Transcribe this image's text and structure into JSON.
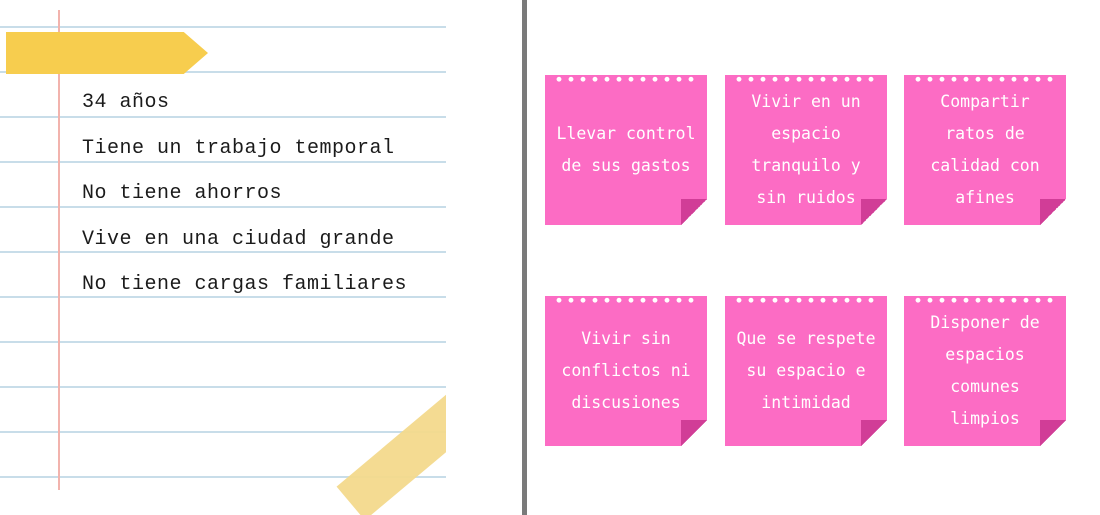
{
  "notebook": {
    "facts": [
      "34 años",
      "Tiene un trabajo temporal",
      "No tiene ahorros",
      "Vive en una ciudad grande",
      "No tiene cargas familiares"
    ]
  },
  "notes": [
    "Llevar control de sus gastos",
    "Vivir en un espacio tranquilo y sin ruidos",
    "Compartir ratos de calidad con afines",
    "Vivir sin conflictos ni discusiones",
    "Que se respete su espacio e intimidad",
    "Disponer de espacios comunes limpios"
  ],
  "colors": {
    "note_pink": "#fc6cc4",
    "tape_yellow": "#f7cd4e",
    "rule_blue": "#c8dde9",
    "margin_red": "#f2b3ad",
    "divider_gray": "#7a7a7a"
  }
}
